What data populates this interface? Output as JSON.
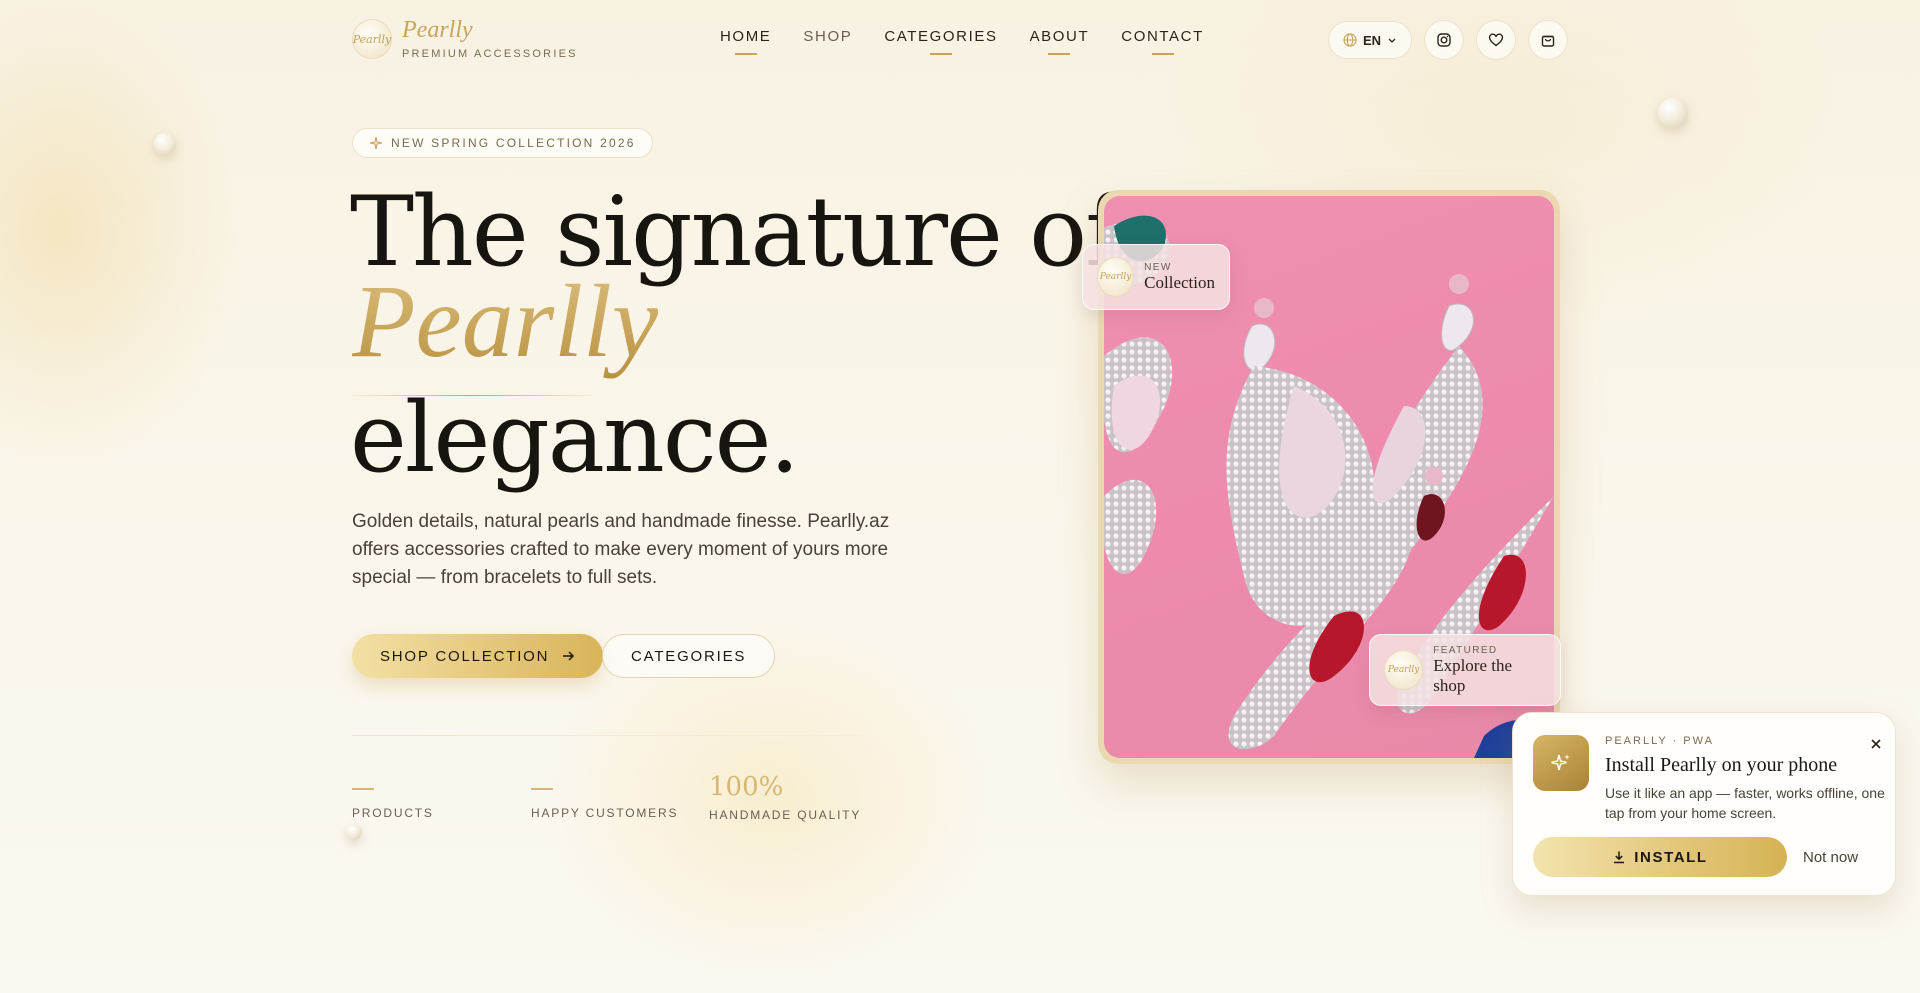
{
  "brand": {
    "name": "Pearlly",
    "tagline": "PREMIUM ACCESSORIES",
    "logo_text": "Pearlly"
  },
  "nav": {
    "items": [
      {
        "label": "HOME"
      },
      {
        "label": "SHOP"
      },
      {
        "label": "CATEGORIES"
      },
      {
        "label": "ABOUT"
      },
      {
        "label": "CONTACT"
      }
    ]
  },
  "header": {
    "language": "EN",
    "icons": [
      "globe-icon",
      "chevron-down-icon",
      "instagram-icon",
      "heart-icon",
      "shopping-bag-icon"
    ]
  },
  "hero": {
    "badge": "NEW SPRING COLLECTION 2026",
    "title_line1": "The signature of",
    "title_line2": "Pearlly",
    "title_line3": "elegance.",
    "description": "Golden details, natural pearls and handmade finesse. Pearlly.az offers accessories crafted to make every moment of yours more special — from bracelets to full sets.",
    "primary_button": "SHOP COLLECTION",
    "secondary_button": "CATEGORIES"
  },
  "stats": [
    {
      "value": "",
      "label": "PRODUCTS"
    },
    {
      "value": "",
      "label": "HAPPY CUSTOMERS"
    },
    {
      "value": "100%",
      "label": "HANDMADE QUALITY"
    }
  ],
  "showcase": {
    "card_new": {
      "kicker": "NEW",
      "title": "Collection",
      "logo_text": "Pearlly"
    },
    "card_featured": {
      "kicker": "FEATURED",
      "title": "Explore the shop",
      "logo_text": "Pearlly"
    }
  },
  "pwa_prompt": {
    "kicker": "PEARLLY · PWA",
    "title": "Install Pearlly on your phone",
    "description": "Use it like an app — faster, works offline, one tap from your home screen.",
    "install_label": "INSTALL",
    "dismiss_label": "Not now"
  },
  "colors": {
    "gold": "#c9a45c",
    "background": "#f8f2e3",
    "text": "#1b1712",
    "image_pink": "#f08fb0"
  }
}
